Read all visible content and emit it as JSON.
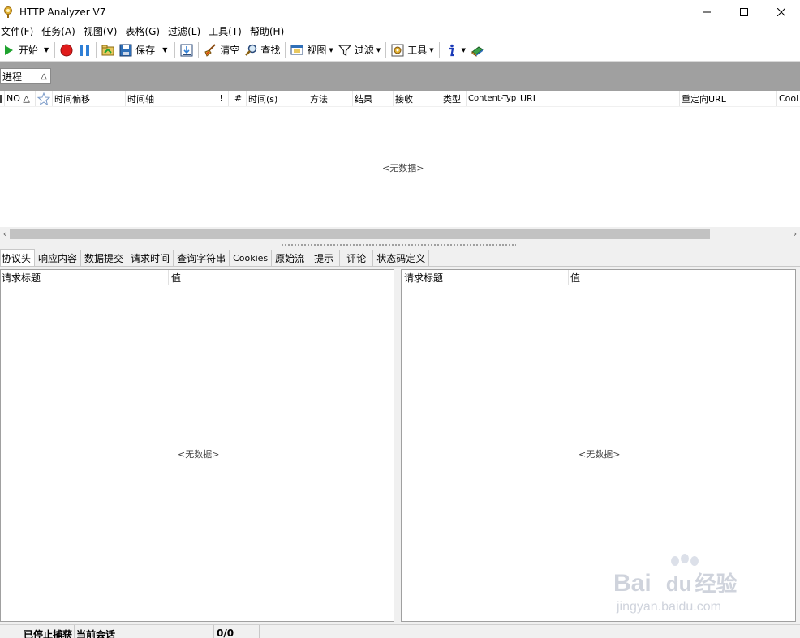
{
  "window": {
    "title": "HTTP Analyzer V7",
    "controls": [
      "minimize-icon",
      "maximize-icon",
      "close-icon"
    ]
  },
  "menu": {
    "items": [
      {
        "label": "文件(F)"
      },
      {
        "label": "任务(A)"
      },
      {
        "label": "视图(V)"
      },
      {
        "label": "表格(G)"
      },
      {
        "label": "过滤(L)"
      },
      {
        "label": "工具(T)"
      },
      {
        "label": "帮助(H)"
      }
    ]
  },
  "toolbar": {
    "start_label": "开始",
    "save_label": "保存",
    "clear_label": "清空",
    "find_label": "查找",
    "view_label": "视图",
    "filter_label": "过滤",
    "tools_label": "工具"
  },
  "grouping": {
    "chip_label": "进程",
    "sort_glyph": "△"
  },
  "grid": {
    "columns": [
      {
        "label": "NO △"
      },
      {
        "label": ""
      },
      {
        "label": "时间偏移"
      },
      {
        "label": "时间轴"
      },
      {
        "label": "!"
      },
      {
        "label": "#"
      },
      {
        "label": "时间(s)"
      },
      {
        "label": "方法"
      },
      {
        "label": "结果"
      },
      {
        "label": "接收"
      },
      {
        "label": "类型"
      },
      {
        "label": "Content-Typ"
      },
      {
        "label": "URL"
      },
      {
        "label": "重定向URL"
      },
      {
        "label": "Cool"
      }
    ],
    "empty_text": "<无数据>"
  },
  "tabs": [
    {
      "label": "协议头",
      "active": true
    },
    {
      "label": "响应内容"
    },
    {
      "label": "数据提交"
    },
    {
      "label": "请求时间"
    },
    {
      "label": "查询字符串"
    },
    {
      "label": "Cookies"
    },
    {
      "label": "原始流"
    },
    {
      "label": "提示"
    },
    {
      "label": "评论"
    },
    {
      "label": "状态码定义"
    }
  ],
  "left_pane": {
    "col_title": "请求标题",
    "col_value": "值",
    "empty_text": "<无数据>"
  },
  "right_pane": {
    "col_title": "请求标题",
    "col_value": "值",
    "empty_text": "<无数据>"
  },
  "status": {
    "capture_state": "已停止捕获",
    "session_label": "当前会话",
    "count": "0/0"
  },
  "watermark": {
    "brand": "Bai",
    "brand2": "du",
    "product": "经验",
    "url": "jingyan.baidu.com"
  },
  "colors": {
    "accent_green": "#1fa32e",
    "record_red": "#e01b1b",
    "pause_blue": "#2f7fd6",
    "group_bar": "#a0a0a0"
  }
}
